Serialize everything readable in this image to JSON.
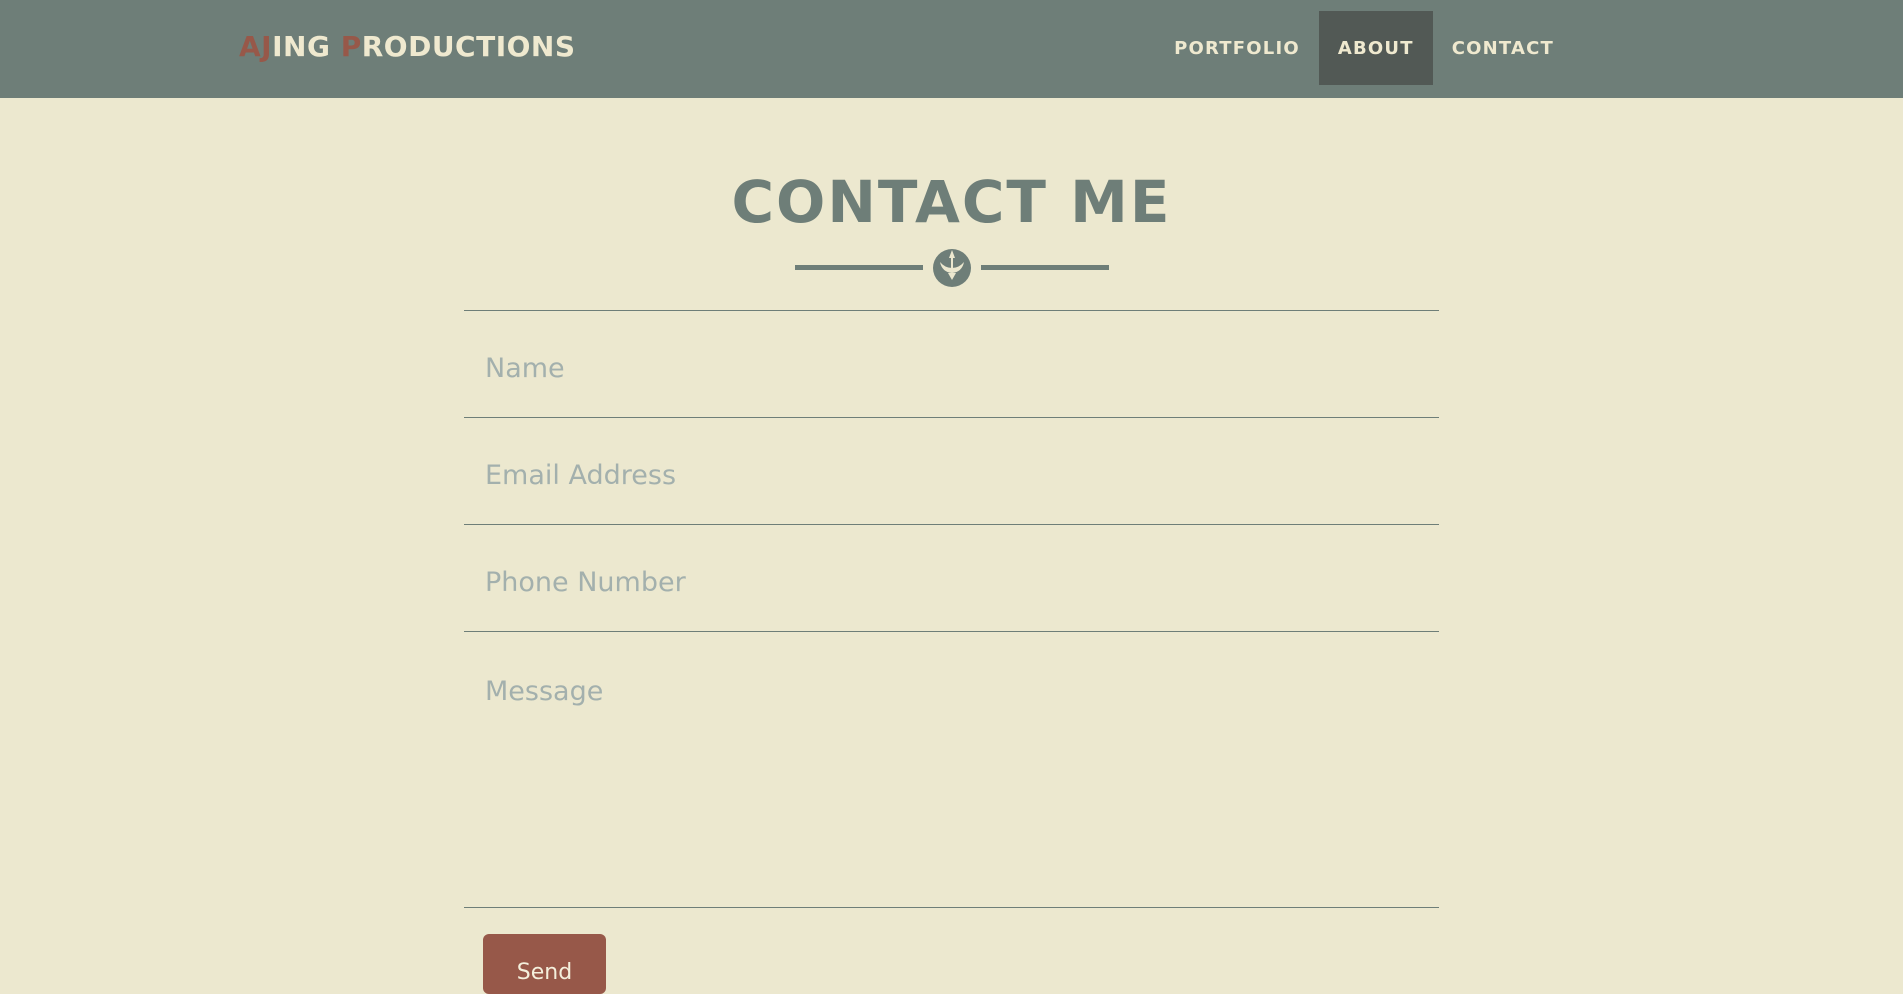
{
  "brand": {
    "parts": [
      {
        "text": "AJ",
        "accent": true
      },
      {
        "text": "ING ",
        "accent": false
      },
      {
        "text": "P",
        "accent": true
      },
      {
        "text": "RODUCTIONS",
        "accent": false
      }
    ]
  },
  "nav": {
    "items": [
      {
        "label": "PORTFOLIO",
        "active": false
      },
      {
        "label": "ABOUT",
        "active": true
      },
      {
        "label": "CONTACT",
        "active": false
      }
    ]
  },
  "contact": {
    "title": "CONTACT ME",
    "divider_icon": "rebel-alliance-icon",
    "fields": {
      "name_placeholder": "Name",
      "email_placeholder": "Email Address",
      "phone_placeholder": "Phone Number",
      "message_placeholder": "Message",
      "name_value": "",
      "email_value": "",
      "phone_value": "",
      "message_value": ""
    },
    "send_label": "Send"
  },
  "colors": {
    "page_background": "#ece8cf",
    "navbar": "#6e7e78",
    "nav_active": "#525955",
    "accent": "#975849",
    "nav_text": "#efe9cf",
    "placeholder": "#a3b0ad"
  }
}
